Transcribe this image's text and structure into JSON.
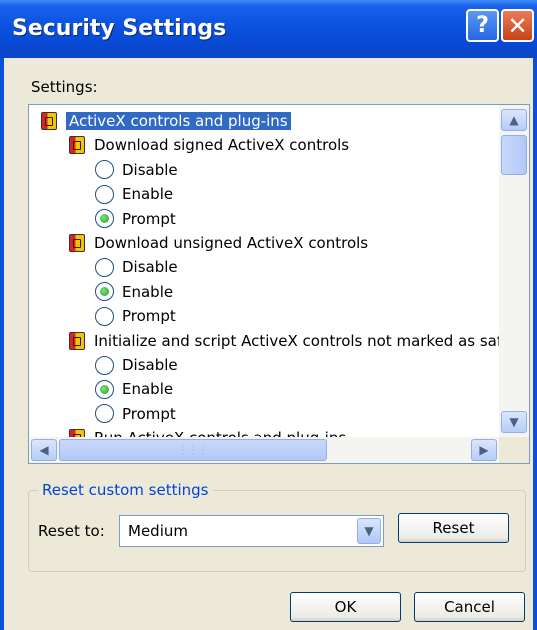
{
  "window": {
    "title": "Security Settings",
    "help_glyph": "?",
    "close_glyph": "✕"
  },
  "settings_label": "Settings:",
  "tree": [
    {
      "kind": "category",
      "label": "ActiveX controls and plug-ins",
      "selected": true
    },
    {
      "kind": "setting",
      "label": "Download signed ActiveX controls"
    },
    {
      "kind": "option",
      "label": "Disable",
      "checked": false
    },
    {
      "kind": "option",
      "label": "Enable",
      "checked": false
    },
    {
      "kind": "option",
      "label": "Prompt",
      "checked": true
    },
    {
      "kind": "setting",
      "label": "Download unsigned ActiveX controls"
    },
    {
      "kind": "option",
      "label": "Disable",
      "checked": false
    },
    {
      "kind": "option",
      "label": "Enable",
      "checked": true
    },
    {
      "kind": "option",
      "label": "Prompt",
      "checked": false
    },
    {
      "kind": "setting",
      "label": "Initialize and script ActiveX controls not marked as safe"
    },
    {
      "kind": "option",
      "label": "Disable",
      "checked": false
    },
    {
      "kind": "option",
      "label": "Enable",
      "checked": true
    },
    {
      "kind": "option",
      "label": "Prompt",
      "checked": false
    },
    {
      "kind": "setting",
      "label": "Run ActiveX controls and plug-ins"
    }
  ],
  "scroll": {
    "up": "▲",
    "down": "▼",
    "left": "◀",
    "right": "▶",
    "grip": "⋮⋮⋮"
  },
  "reset_group": {
    "legend": "Reset custom settings",
    "reset_to_label": "Reset to:",
    "selected_level": "Medium",
    "dropdown_glyph": "▼",
    "reset_button": "Reset"
  },
  "footer": {
    "ok": "OK",
    "cancel": "Cancel"
  }
}
